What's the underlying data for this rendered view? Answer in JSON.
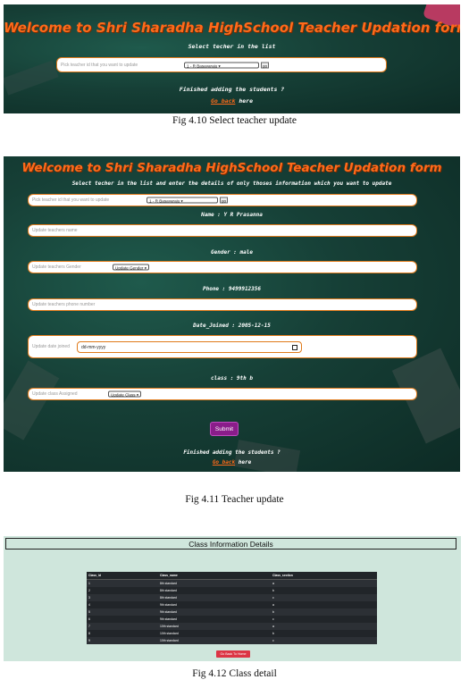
{
  "fig1": {
    "title": "Welcome to Shri Sharadha HighSchool Teacher Updation form",
    "subtitle": "Select techer in the list",
    "field_placeholder": "Pick teacher id that you want to update",
    "select_value": "1 - R Basavaraju",
    "go_label": "go",
    "finished_text": "Finished adding the students ?",
    "go_back_label": "Go back",
    "here_text": "here",
    "caption": "Fig 4.10 Select teacher update"
  },
  "fig2": {
    "title": "Welcome to Shri Sharadha HighSchool Teacher Updation form",
    "subtitle": "Select techer in the list and enter the details of only thoses information which you want to update",
    "pick_placeholder": "Pick teacher id that you want to update",
    "select_value": "1 - R Basavaraju",
    "go_label": "go",
    "name_info": "Name : Y R Prasanna",
    "name_placeholder": "Update teachers name",
    "gender_info": "Gender : male",
    "gender_placeholder": "Update teachers Gender",
    "gender_select": "Update Gender",
    "phone_info": "Phone : 9499912356",
    "phone_placeholder": "Update teachers phone number",
    "date_info": "Date_Joined : 2005-12-15",
    "date_placeholder": "Update date joined",
    "date_value": "dd-mm-yyyy",
    "class_info": "class : 9th b",
    "class_placeholder": "Update class Assigned",
    "class_select": "Update Class",
    "submit_label": "Submit",
    "finished_text": "Finished adding the students ?",
    "go_back_label": "Go back",
    "here_text": "here",
    "caption": "Fig 4.11 Teacher update"
  },
  "fig3": {
    "title": "Class Information Details",
    "columns": [
      "Class_id",
      "Class_name",
      "Class_section"
    ],
    "rows": [
      [
        "1",
        "8th standard",
        "a"
      ],
      [
        "2",
        "8th standard",
        "b"
      ],
      [
        "3",
        "8th standard",
        "c"
      ],
      [
        "4",
        "9th standard",
        "a"
      ],
      [
        "5",
        "9th standard",
        "b"
      ],
      [
        "6",
        "9th standard",
        "c"
      ],
      [
        "7",
        "10th standard",
        "a"
      ],
      [
        "8",
        "10th standard",
        "b"
      ],
      [
        "9",
        "10th standard",
        "c"
      ]
    ],
    "button_label": "Go Back To Home",
    "caption": "Fig 4.12 Class detail"
  }
}
